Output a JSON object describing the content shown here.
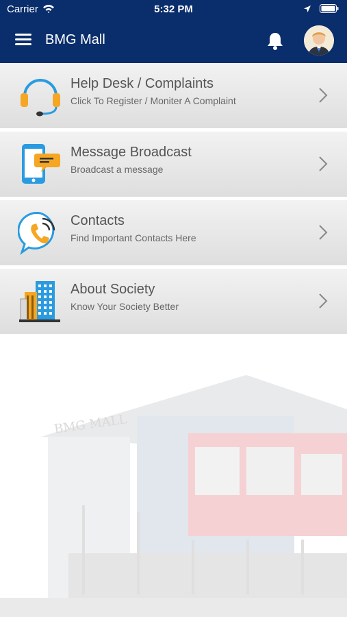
{
  "status_bar": {
    "carrier": "Carrier",
    "time": "5:32 PM"
  },
  "header": {
    "title": "BMG Mall"
  },
  "menu_items": [
    {
      "title": "Help Desk / Complaints",
      "subtitle": "Click To Register / Moniter A Complaint",
      "icon": "headset-icon"
    },
    {
      "title": "Message Broadcast",
      "subtitle": "Broadcast a message",
      "icon": "phone-message-icon"
    },
    {
      "title": "Contacts",
      "subtitle": "Find Important Contacts Here",
      "icon": "phone-call-icon"
    },
    {
      "title": "About Society",
      "subtitle": "Know Your Society Better",
      "icon": "buildings-icon"
    }
  ],
  "background": {
    "sign_text": "BMG MALL"
  },
  "colors": {
    "header_bg": "#0a2d6b",
    "accent_blue": "#2a9be0",
    "accent_orange": "#f5a623"
  }
}
